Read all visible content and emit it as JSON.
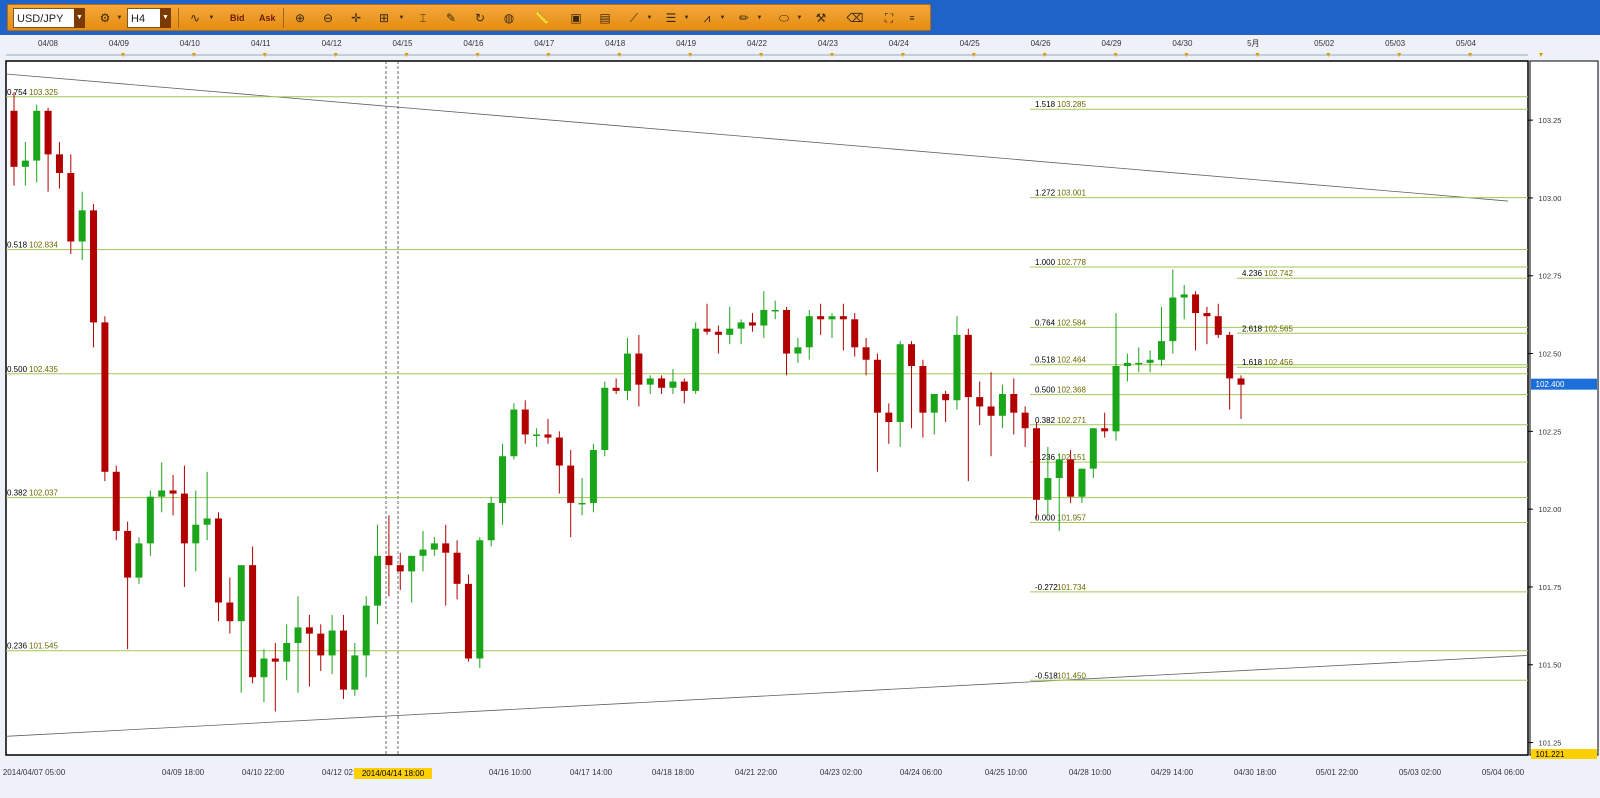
{
  "toolbar": {
    "symbol": "USD/JPY",
    "timeframe": "H4",
    "bid_label": "Bid",
    "ask_label": "Ask"
  },
  "chart_data": {
    "type": "candlestick",
    "symbol": "USD/JPY",
    "timeframe": "H4",
    "colors": {
      "bull": "#1aa51a",
      "bear": "#b20000",
      "fib": "#a3c759",
      "current_price_bg": "#1c6ed8"
    },
    "top_dates": [
      "04/08",
      "04/09",
      "04/10",
      "04/11",
      "04/12",
      "04/15",
      "04/16",
      "04/17",
      "04/18",
      "04/19",
      "04/22",
      "04/23",
      "04/24",
      "04/25",
      "04/26",
      "04/29",
      "04/30",
      "5月",
      "05/02",
      "05/03",
      "05/04"
    ],
    "bottom_labels": [
      "2014/04/07 05:00",
      "04/09 18:00",
      "04/10 22:00",
      "04/12 02:00",
      "04/16 10:00",
      "04/17 14:00",
      "04/18 18:00",
      "04/21 22:00",
      "04/23 02:00",
      "04/24 06:00",
      "04/25 10:00",
      "04/28 10:00",
      "04/29 14:00",
      "04/30 18:00",
      "05/01 22:00",
      "05/03 02:00",
      "05/04 06:00"
    ],
    "crosshair_label": "2014/04/14 18:00",
    "y_ticks": [
      "103.25",
      "103.00",
      "102.75",
      "102.50",
      "102.25",
      "102.00",
      "101.75",
      "101.50",
      "101.25"
    ],
    "y_range": [
      101.21,
      103.44
    ],
    "current_price": "102.400",
    "bottom_price": "101.221",
    "fib_left": [
      {
        "label": "0.754",
        "value": "103.325"
      },
      {
        "label": "0.518",
        "value": "102.834"
      },
      {
        "label": "0.500",
        "value": "102.435"
      },
      {
        "label": "0.382",
        "value": "102.037"
      },
      {
        "label": "0.236",
        "value": "101.545"
      }
    ],
    "fib_right": [
      {
        "label": "1.518",
        "value": "103.285"
      },
      {
        "label": "1.272",
        "value": "103.001"
      },
      {
        "label": "1.000",
        "value": "102.778"
      },
      {
        "label": "0.764",
        "value": "102.584"
      },
      {
        "label": "0.518",
        "value": "102.464"
      },
      {
        "label": "0.500",
        "value": "102.368"
      },
      {
        "label": "0.382",
        "value": "102.271"
      },
      {
        "label": "0.236",
        "value": "102.151"
      },
      {
        "label": "0.000",
        "value": "101.957"
      },
      {
        "label": "-0.272",
        "value": "101.734"
      },
      {
        "label": "-0.518",
        "value": "101.450"
      }
    ],
    "fib_ext": [
      {
        "label": "4.236",
        "value": "102.742"
      },
      {
        "label": "2.618",
        "value": "102.565"
      },
      {
        "label": "1.618",
        "value": "102.456"
      }
    ],
    "candles": [
      [
        103.28,
        103.34,
        103.04,
        103.1
      ],
      [
        103.1,
        103.18,
        103.04,
        103.12
      ],
      [
        103.12,
        103.3,
        103.05,
        103.28
      ],
      [
        103.28,
        103.29,
        103.02,
        103.14
      ],
      [
        103.14,
        103.18,
        103.03,
        103.08
      ],
      [
        103.08,
        103.14,
        102.82,
        102.86
      ],
      [
        102.86,
        103.02,
        102.8,
        102.96
      ],
      [
        102.96,
        102.98,
        102.52,
        102.6
      ],
      [
        102.6,
        102.62,
        102.09,
        102.12
      ],
      [
        102.12,
        102.14,
        101.9,
        101.93
      ],
      [
        101.93,
        101.96,
        101.55,
        101.78
      ],
      [
        101.78,
        101.91,
        101.76,
        101.89
      ],
      [
        101.89,
        102.06,
        101.85,
        102.04
      ],
      [
        102.04,
        102.15,
        101.99,
        102.06
      ],
      [
        102.06,
        102.11,
        101.98,
        102.05
      ],
      [
        102.05,
        102.14,
        101.75,
        101.89
      ],
      [
        101.89,
        102.06,
        101.8,
        101.95
      ],
      [
        101.95,
        102.12,
        101.9,
        101.97
      ],
      [
        101.97,
        101.99,
        101.64,
        101.7
      ],
      [
        101.7,
        101.78,
        101.6,
        101.64
      ],
      [
        101.64,
        101.81,
        101.41,
        101.82
      ],
      [
        101.82,
        101.88,
        101.44,
        101.46
      ],
      [
        101.46,
        101.55,
        101.38,
        101.52
      ],
      [
        101.52,
        101.57,
        101.35,
        101.51
      ],
      [
        101.51,
        101.63,
        101.45,
        101.57
      ],
      [
        101.57,
        101.72,
        101.41,
        101.62
      ],
      [
        101.62,
        101.66,
        101.43,
        101.6
      ],
      [
        101.6,
        101.63,
        101.48,
        101.53
      ],
      [
        101.53,
        101.66,
        101.47,
        101.61
      ],
      [
        101.61,
        101.66,
        101.39,
        101.42
      ],
      [
        101.42,
        101.57,
        101.4,
        101.53
      ],
      [
        101.53,
        101.72,
        101.46,
        101.69
      ],
      [
        101.69,
        101.95,
        101.63,
        101.85
      ],
      [
        101.85,
        101.98,
        101.72,
        101.82
      ],
      [
        101.82,
        101.86,
        101.74,
        101.8
      ],
      [
        101.8,
        101.84,
        101.7,
        101.85
      ],
      [
        101.85,
        101.93,
        101.8,
        101.87
      ],
      [
        101.87,
        101.91,
        101.85,
        101.89
      ],
      [
        101.89,
        101.95,
        101.69,
        101.86
      ],
      [
        101.86,
        101.9,
        101.71,
        101.76
      ],
      [
        101.76,
        101.79,
        101.51,
        101.52
      ],
      [
        101.52,
        101.91,
        101.49,
        101.9
      ],
      [
        101.9,
        102.04,
        101.88,
        102.02
      ],
      [
        102.02,
        102.21,
        101.95,
        102.17
      ],
      [
        102.17,
        102.34,
        102.16,
        102.32
      ],
      [
        102.32,
        102.35,
        102.21,
        102.24
      ],
      [
        102.24,
        102.26,
        102.2,
        102.24
      ],
      [
        102.24,
        102.29,
        102.21,
        102.23
      ],
      [
        102.23,
        102.25,
        102.05,
        102.14
      ],
      [
        102.14,
        102.19,
        101.91,
        102.02
      ],
      [
        102.02,
        102.1,
        101.98,
        102.02
      ],
      [
        102.02,
        102.21,
        101.99,
        102.19
      ],
      [
        102.19,
        102.41,
        102.17,
        102.39
      ],
      [
        102.39,
        102.42,
        102.37,
        102.38
      ],
      [
        102.38,
        102.55,
        102.35,
        102.5
      ],
      [
        102.5,
        102.56,
        102.33,
        102.4
      ],
      [
        102.4,
        102.43,
        102.37,
        102.42
      ],
      [
        102.42,
        102.43,
        102.37,
        102.39
      ],
      [
        102.39,
        102.45,
        102.37,
        102.41
      ],
      [
        102.41,
        102.42,
        102.34,
        102.38
      ],
      [
        102.38,
        102.6,
        102.37,
        102.58
      ],
      [
        102.58,
        102.66,
        102.56,
        102.57
      ],
      [
        102.57,
        102.59,
        102.5,
        102.56
      ],
      [
        102.56,
        102.65,
        102.53,
        102.58
      ],
      [
        102.58,
        102.61,
        102.53,
        102.6
      ],
      [
        102.6,
        102.63,
        102.57,
        102.59
      ],
      [
        102.59,
        102.7,
        102.55,
        102.64
      ],
      [
        102.64,
        102.67,
        102.61,
        102.64
      ],
      [
        102.64,
        102.65,
        102.43,
        102.5
      ],
      [
        102.5,
        102.55,
        102.47,
        102.52
      ],
      [
        102.52,
        102.64,
        102.48,
        102.62
      ],
      [
        102.62,
        102.66,
        102.56,
        102.61
      ],
      [
        102.61,
        102.63,
        102.55,
        102.62
      ],
      [
        102.62,
        102.66,
        102.51,
        102.61
      ],
      [
        102.61,
        102.63,
        102.49,
        102.52
      ],
      [
        102.52,
        102.55,
        102.43,
        102.48
      ],
      [
        102.48,
        102.5,
        102.12,
        102.31
      ],
      [
        102.31,
        102.34,
        102.21,
        102.28
      ],
      [
        102.28,
        102.54,
        102.2,
        102.53
      ],
      [
        102.53,
        102.54,
        102.26,
        102.46
      ],
      [
        102.46,
        102.48,
        102.23,
        102.31
      ],
      [
        102.31,
        102.34,
        102.24,
        102.37
      ],
      [
        102.37,
        102.38,
        102.28,
        102.35
      ],
      [
        102.35,
        102.62,
        102.32,
        102.56
      ],
      [
        102.56,
        102.58,
        102.09,
        102.36
      ],
      [
        102.36,
        102.41,
        102.27,
        102.33
      ],
      [
        102.33,
        102.44,
        102.17,
        102.3
      ],
      [
        102.3,
        102.4,
        102.26,
        102.37
      ],
      [
        102.37,
        102.42,
        102.24,
        102.31
      ],
      [
        102.31,
        102.33,
        102.2,
        102.26
      ],
      [
        102.26,
        102.28,
        101.97,
        102.03
      ],
      [
        102.03,
        102.2,
        101.98,
        102.1
      ],
      [
        102.1,
        102.18,
        101.93,
        102.16
      ],
      [
        102.16,
        102.19,
        102.02,
        102.04
      ],
      [
        102.04,
        102.13,
        102.02,
        102.13
      ],
      [
        102.13,
        102.26,
        102.1,
        102.26
      ],
      [
        102.26,
        102.31,
        102.23,
        102.25
      ],
      [
        102.25,
        102.63,
        102.22,
        102.46
      ],
      [
        102.46,
        102.5,
        102.41,
        102.47
      ],
      [
        102.47,
        102.52,
        102.44,
        102.47
      ],
      [
        102.47,
        102.51,
        102.44,
        102.48
      ],
      [
        102.48,
        102.65,
        102.46,
        102.54
      ],
      [
        102.54,
        102.77,
        102.5,
        102.68
      ],
      [
        102.68,
        102.72,
        102.61,
        102.69
      ],
      [
        102.69,
        102.7,
        102.51,
        102.63
      ],
      [
        102.63,
        102.65,
        102.53,
        102.62
      ],
      [
        102.62,
        102.66,
        102.55,
        102.56
      ],
      [
        102.56,
        102.57,
        102.32,
        102.42
      ],
      [
        102.42,
        102.43,
        102.29,
        102.4
      ]
    ]
  }
}
